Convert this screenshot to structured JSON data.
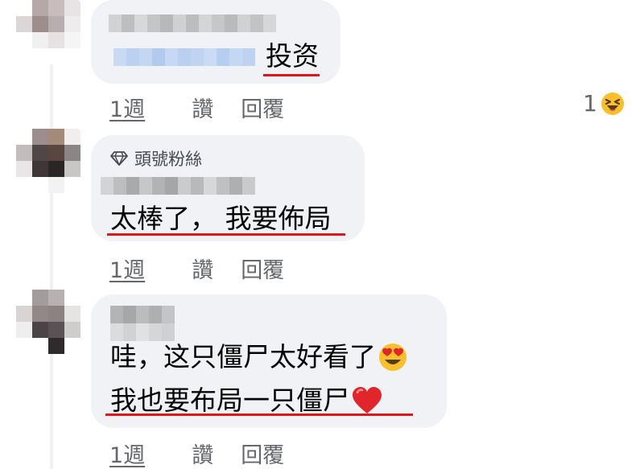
{
  "comments": [
    {
      "text": "投资",
      "time": "1週",
      "like_label": "讚",
      "reply_label": "回覆",
      "reaction_count": "1"
    },
    {
      "badge": "頭號粉絲",
      "text": "太棒了， 我要佈局",
      "time": "1週",
      "like_label": "讚",
      "reply_label": "回覆"
    },
    {
      "line1": "哇，这只僵尸太好看了",
      "line2": "我也要布局一只僵尸",
      "time": "1週",
      "like_label": "讚",
      "reply_label": "回覆"
    }
  ],
  "colors": {
    "bubble": "#f0f2f5",
    "underline": "#e0161b",
    "meta_text": "#65676b"
  },
  "icons": [
    "diamond-fan-icon",
    "laughing-emoji-icon",
    "heart-eyes-emoji-icon",
    "red-heart-icon"
  ]
}
